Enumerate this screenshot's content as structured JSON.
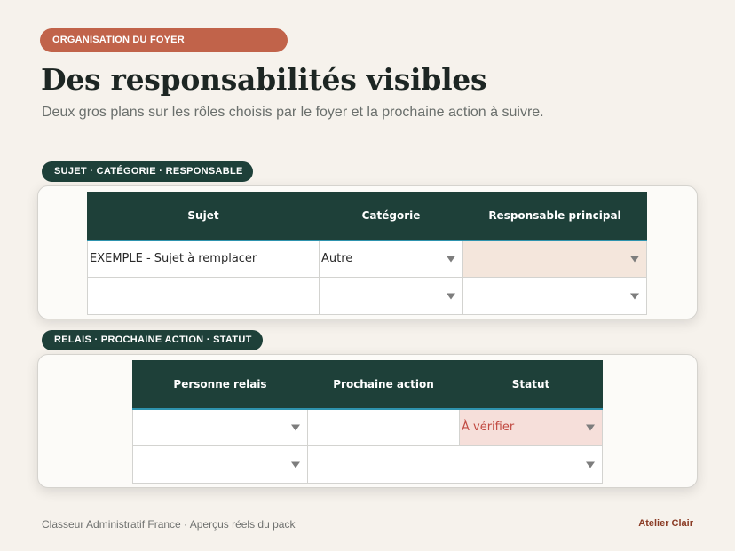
{
  "kicker": "ORGANISATION DU FOYER",
  "title": "Des responsabilités visibles",
  "subtitle": "Deux gros plans sur les rôles choisis par le foyer et la prochaine action à suivre.",
  "section1": {
    "label": "SUJET · CATÉGORIE · RESPONSABLE",
    "headers": [
      "Sujet",
      "Catégorie",
      "Responsable principal"
    ],
    "rows": [
      [
        "EXEMPLE - Sujet à remplacer",
        "Autre",
        ""
      ],
      [
        "",
        "",
        ""
      ]
    ]
  },
  "section2": {
    "label": "RELAIS · PROCHAINE ACTION · STATUT",
    "headers": [
      "Personne relais",
      "Prochaine action",
      "Statut"
    ],
    "rows": [
      [
        "",
        "",
        "À vérifier"
      ],
      [
        "",
        "",
        ""
      ]
    ]
  },
  "footer": {
    "left": "Classeur Administratif France · Aperçus réels du pack",
    "right": "Atelier Clair"
  },
  "colors": {
    "accent": "#c1634a",
    "header_dark_green": "#1e4039",
    "peach_fill": "#f4e6dc",
    "pink_fill": "#f6dfda",
    "status_red": "#c14a42"
  },
  "icons": [
    "dropdown-arrow-icon"
  ]
}
